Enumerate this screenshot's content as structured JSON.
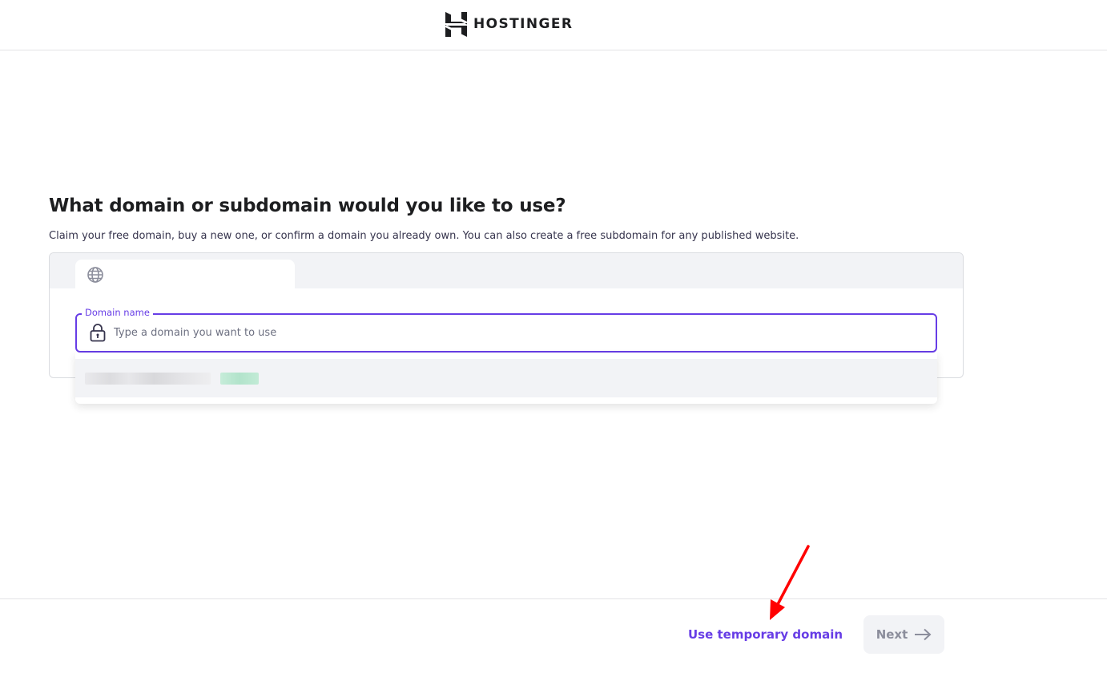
{
  "header": {
    "brand": "HOSTINGER",
    "icon": "hostinger-logo-icon"
  },
  "main": {
    "title": "What domain or subdomain would you like to use?",
    "subtitle": "Claim your free domain, buy a new one, or confirm a domain you already own. You can also create a free subdomain for any published website.",
    "tabs": [
      {
        "icon": "globe-icon",
        "active": true
      }
    ],
    "domain_field": {
      "label": "Domain name",
      "placeholder": "Type a domain you want to use",
      "value": "",
      "icon": "lock-icon"
    },
    "suggestions": [
      {
        "text": "████████████",
        "badge": "████",
        "blurred": true
      }
    ]
  },
  "footer": {
    "temporary_label": "Use temporary domain",
    "next_label": "Next",
    "next_icon": "arrow-right-icon",
    "next_disabled": true
  },
  "colors": {
    "accent": "#673de6",
    "annotation": "#ff0000",
    "disabled_bg": "#f2f3f6",
    "disabled_text": "#8c8e9c"
  }
}
